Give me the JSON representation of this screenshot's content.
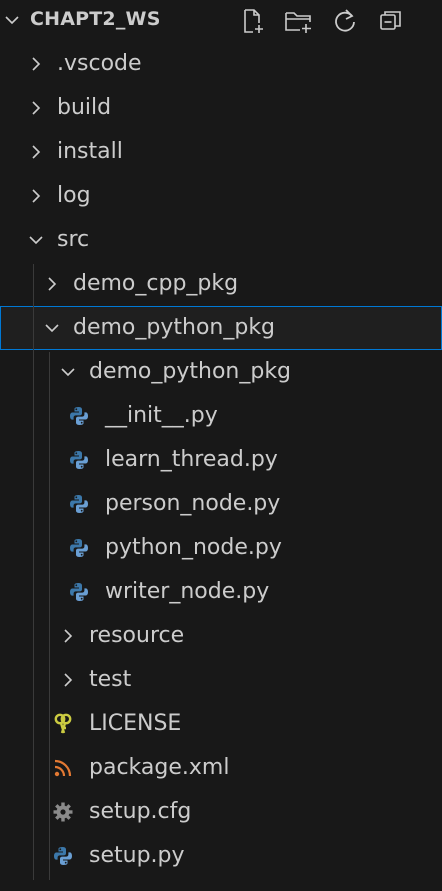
{
  "explorer": {
    "title": "CHAPT2_WS",
    "actions": [
      {
        "name": "new-file-icon"
      },
      {
        "name": "new-folder-icon"
      },
      {
        "name": "refresh-icon"
      },
      {
        "name": "collapse-all-icon"
      }
    ]
  },
  "tree": [
    {
      "label": ".vscode",
      "kind": "folder",
      "expanded": false,
      "depth": 1,
      "name": "tree-item-vscode"
    },
    {
      "label": "build",
      "kind": "folder",
      "expanded": false,
      "depth": 1,
      "name": "tree-item-build"
    },
    {
      "label": "install",
      "kind": "folder",
      "expanded": false,
      "depth": 1,
      "name": "tree-item-install"
    },
    {
      "label": "log",
      "kind": "folder",
      "expanded": false,
      "depth": 1,
      "name": "tree-item-log"
    },
    {
      "label": "src",
      "kind": "folder",
      "expanded": true,
      "depth": 1,
      "name": "tree-item-src"
    },
    {
      "label": "demo_cpp_pkg",
      "kind": "folder",
      "expanded": false,
      "depth": 2,
      "name": "tree-item-demo-cpp-pkg"
    },
    {
      "label": "demo_python_pkg",
      "kind": "folder",
      "expanded": true,
      "depth": 2,
      "selected": true,
      "name": "tree-item-demo-python-pkg"
    },
    {
      "label": "demo_python_pkg",
      "kind": "folder",
      "expanded": true,
      "depth": 3,
      "name": "tree-item-demo-python-pkg-inner"
    },
    {
      "label": "__init__.py",
      "kind": "python",
      "depth": 4,
      "name": "tree-item-init-py"
    },
    {
      "label": "learn_thread.py",
      "kind": "python",
      "depth": 4,
      "name": "tree-item-learn-thread-py"
    },
    {
      "label": "person_node.py",
      "kind": "python",
      "depth": 4,
      "name": "tree-item-person-node-py"
    },
    {
      "label": "python_node.py",
      "kind": "python",
      "depth": 4,
      "name": "tree-item-python-node-py"
    },
    {
      "label": "writer_node.py",
      "kind": "python",
      "depth": 4,
      "name": "tree-item-writer-node-py"
    },
    {
      "label": "resource",
      "kind": "folder",
      "expanded": false,
      "depth": 3,
      "name": "tree-item-resource"
    },
    {
      "label": "test",
      "kind": "folder",
      "expanded": false,
      "depth": 3,
      "name": "tree-item-test"
    },
    {
      "label": "LICENSE",
      "kind": "license",
      "depth": 3,
      "name": "tree-item-license"
    },
    {
      "label": "package.xml",
      "kind": "rss",
      "depth": 3,
      "name": "tree-item-package-xml"
    },
    {
      "label": "setup.cfg",
      "kind": "gear",
      "depth": 3,
      "name": "tree-item-setup-cfg"
    },
    {
      "label": "setup.py",
      "kind": "python",
      "depth": 3,
      "name": "tree-item-setup-py"
    }
  ],
  "colors": {
    "background": "#181818",
    "text": "#cccccc",
    "selection_border": "#0078d4",
    "python_blue": "#3c78aa",
    "python_light": "#6a9fd4",
    "license_yellow": "#cbcb41",
    "rss_orange": "#e37933",
    "gear_gray": "#8a8a8a"
  }
}
